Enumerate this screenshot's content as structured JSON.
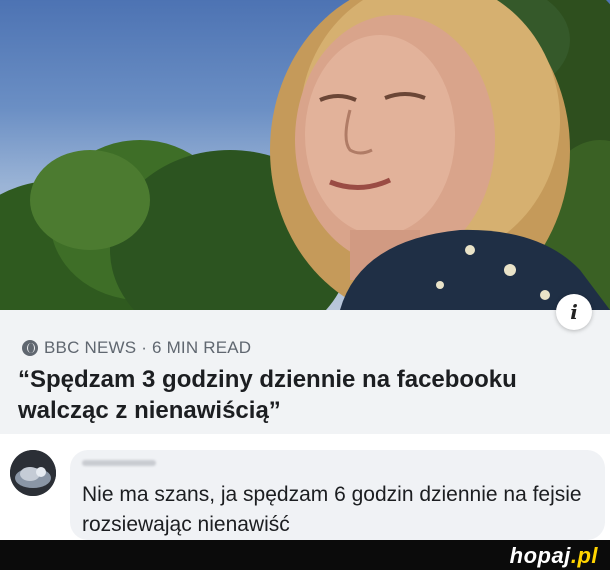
{
  "article": {
    "source_icon": "globe-icon",
    "source_line": "BBC NEWS · 6 MIN READ",
    "headline": "“Spędzam 3 godziny dziennie na facebooku walcząc z nienawiścią”",
    "info_icon": "info-icon",
    "info_label": "i"
  },
  "comment": {
    "text": "Nie ma szans, ja spędzam 6 godzin dziennie na fejsie rozsiewając nienawiść"
  },
  "footer": {
    "brand_main": "hopaj",
    "brand_dot": ".pl"
  },
  "colors": {
    "card_bg": "#f1f3f5",
    "text_primary": "#1c1e21",
    "text_secondary": "#606770",
    "brand_accent": "#ffd400"
  }
}
